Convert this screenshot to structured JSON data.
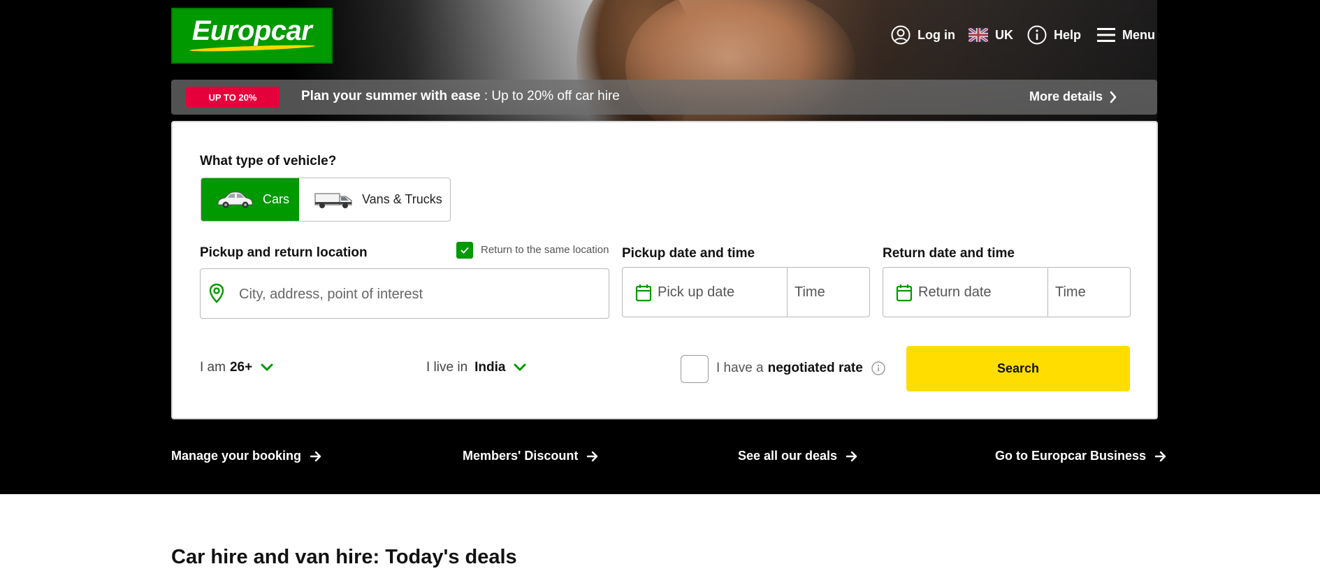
{
  "header": {
    "logo_text": "Europcar",
    "nav": [
      {
        "icon": "user-circle-icon",
        "label": "Log in"
      },
      {
        "icon": "uk-flag-icon",
        "label": "UK"
      },
      {
        "icon": "info-circle-icon",
        "label": "Help"
      },
      {
        "icon": "hamburger-menu-icon",
        "label": "Menu"
      }
    ]
  },
  "promo": {
    "badge": "UP TO 20%",
    "bold_text": "Plan your summer with ease",
    "text": " : Up to 20% off car hire",
    "more_label": "More details"
  },
  "booking": {
    "vehicle_heading": "What type of vehicle?",
    "vehicle_types": [
      {
        "label": "Cars",
        "selected": true
      },
      {
        "label": "Vans & Trucks",
        "selected": false
      }
    ],
    "location_label": "Pickup and return location",
    "same_location_label": "Return to the same location",
    "same_location_checked": true,
    "location_placeholder": "City, address, point of interest",
    "pickup_label": "Pickup date and time",
    "pickup_date_placeholder": "Pick up date",
    "pickup_time_placeholder": "Time",
    "return_label": "Return date and time",
    "return_date_placeholder": "Return date",
    "return_time_placeholder": "Time",
    "age_prefix": "I am",
    "age_value": "26+",
    "residence_prefix": "I live in",
    "residence_value": "India",
    "negotiated_prefix": "I have a",
    "negotiated_bold": "negotiated rate",
    "search_label": "Search"
  },
  "quick_links": [
    {
      "label": "Manage your booking"
    },
    {
      "label": "Members' Discount"
    },
    {
      "label": "See all our deals"
    },
    {
      "label": "Go to Europcar Business"
    }
  ],
  "deals_title": "Car hire and van hire: Today's deals",
  "colors": {
    "brand_green": "#009900",
    "search_yellow": "#ffdd00",
    "promo_red": "#e5003c"
  }
}
